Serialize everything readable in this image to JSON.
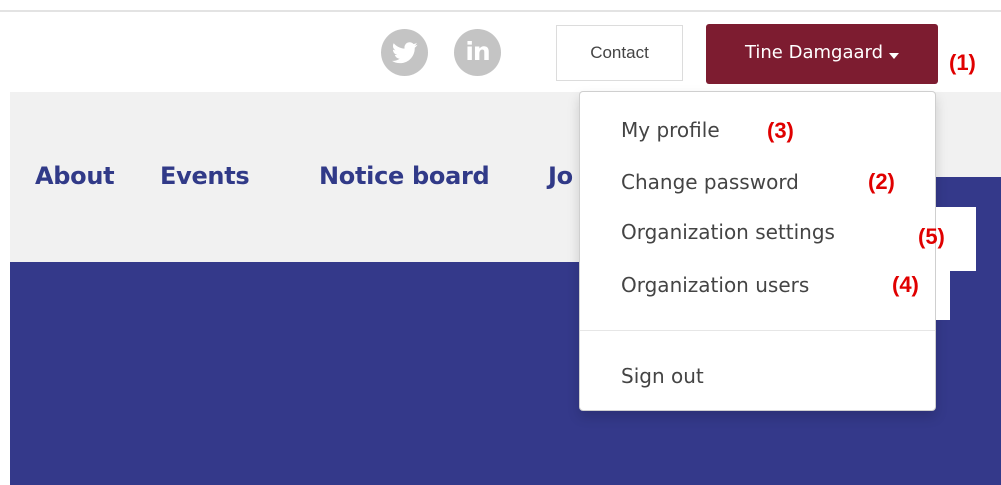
{
  "header": {
    "social": [
      {
        "name": "twitter-icon"
      },
      {
        "name": "linkedin-icon",
        "glyph": "in"
      }
    ],
    "contact_label": "Contact",
    "user_label": "Tine Damgaard"
  },
  "nav": {
    "items": [
      "About",
      "Events",
      "Notice board",
      "Jo"
    ]
  },
  "dropdown": {
    "items": [
      "My profile",
      "Change password",
      "Organization settings",
      "Organization users"
    ],
    "signout_label": "Sign out"
  },
  "annotations": {
    "a1": "(1)",
    "a2": "(2)",
    "a3": "(3)",
    "a4": "(4)",
    "a5": "(5)"
  },
  "colors": {
    "accent_user_button": "#7d1c30",
    "nav_text": "#313a88",
    "hero": "#34398a",
    "annotation": "#e00000"
  }
}
